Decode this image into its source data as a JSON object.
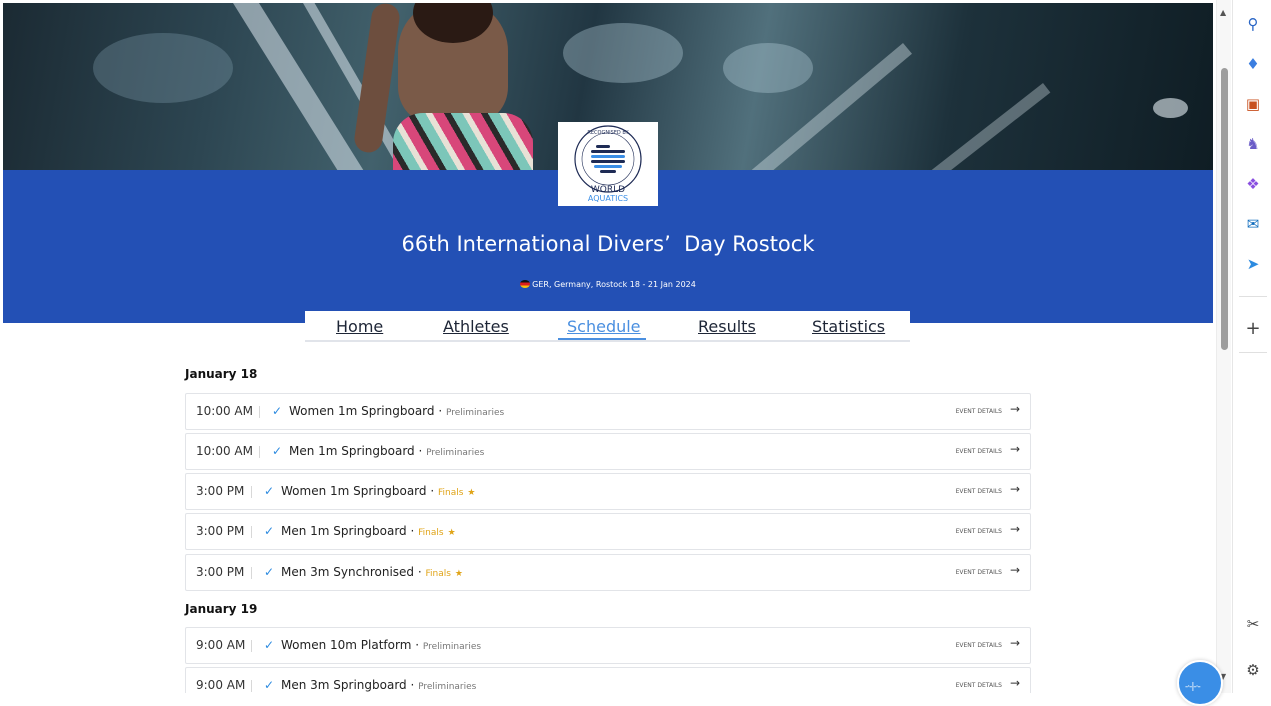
{
  "event": {
    "title": "66th International Divers’  Day Rostock",
    "subtitle": "GER, Germany, Rostock 18 - 21 Jan 2024",
    "logo_arc_text": "RECOGNISED BY",
    "logo_line1": "WORLD",
    "logo_line2": "AQUATICS"
  },
  "nav": {
    "tabs": [
      {
        "label": "Home"
      },
      {
        "label": "Athletes"
      },
      {
        "label": "Schedule"
      },
      {
        "label": "Results"
      },
      {
        "label": "Statistics"
      }
    ],
    "active": "Schedule"
  },
  "schedule": {
    "details_label": "EVENT DETAILS",
    "days": [
      {
        "date": "January 18",
        "events": [
          {
            "time": "10:00 AM",
            "name": "Women 1m Springboard",
            "phase": "Preliminaries",
            "final": false
          },
          {
            "time": "10:00 AM",
            "name": "Men 1m Springboard",
            "phase": "Preliminaries",
            "final": false
          },
          {
            "time": "3:00 PM",
            "name": "Women 1m Springboard",
            "phase": "Finals",
            "final": true
          },
          {
            "time": "3:00 PM",
            "name": "Men 1m Springboard",
            "phase": "Finals",
            "final": true
          },
          {
            "time": "3:00 PM",
            "name": "Men 3m Synchronised",
            "phase": "Finals",
            "final": true
          }
        ]
      },
      {
        "date": "January 19",
        "events": [
          {
            "time": "9:00 AM",
            "name": "Women 10m Platform",
            "phase": "Preliminaries",
            "final": false
          },
          {
            "time": "9:00 AM",
            "name": "Men 3m Springboard",
            "phase": "Preliminaries",
            "final": false
          }
        ]
      }
    ]
  },
  "colors": {
    "band": "#2350b5",
    "active_tab": "#4a8fe0",
    "finals": "#e0a418"
  },
  "sidebar": {
    "icons": [
      "search-icon",
      "tag-icon",
      "toolbox-icon",
      "chess-icon",
      "copilot-icon",
      "outlook-icon",
      "send-icon",
      "add-icon",
      "screenshot-icon",
      "settings-icon"
    ]
  }
}
